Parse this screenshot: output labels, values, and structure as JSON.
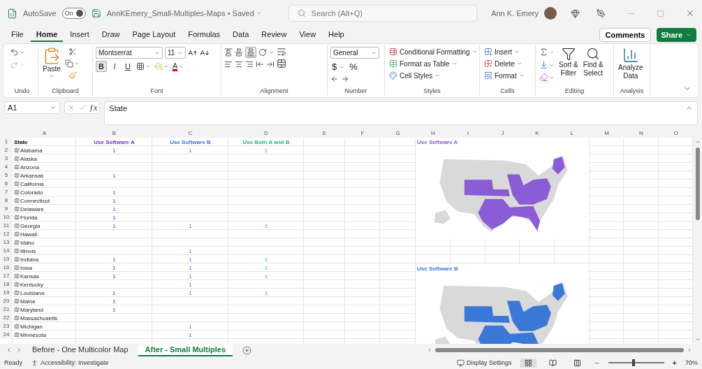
{
  "title_bar": {
    "autosave_label": "AutoSave",
    "autosave": {
      "on": true,
      "label": "On"
    },
    "file_name": "AnnKEmery_Small-Multiples-Maps • Saved",
    "search": {
      "placeholder": "Search (Alt+Q)"
    },
    "user_name": "Ann K. Emery"
  },
  "menu_tabs": [
    {
      "label": "File",
      "selected": false
    },
    {
      "label": "Home",
      "selected": true
    },
    {
      "label": "Insert",
      "selected": false
    },
    {
      "label": "Draw",
      "selected": false
    },
    {
      "label": "Page Layout",
      "selected": false
    },
    {
      "label": "Formulas",
      "selected": false
    },
    {
      "label": "Data",
      "selected": false
    },
    {
      "label": "Review",
      "selected": false
    },
    {
      "label": "View",
      "selected": false
    },
    {
      "label": "Help",
      "selected": false
    }
  ],
  "comments_button": "Comments",
  "share_button": "Share",
  "ribbon": [
    {
      "kind": "undo",
      "label": "Undo"
    },
    {
      "kind": "clipboard",
      "label": "Clipboard",
      "paste": "Paste"
    },
    {
      "kind": "font",
      "label": "Font",
      "family": "Montserrat",
      "size": "11",
      "bold": "B",
      "italic": "I",
      "underline": "U",
      "font_color": "A"
    },
    {
      "kind": "alignment",
      "label": "Alignment"
    },
    {
      "kind": "number",
      "label": "Number",
      "format": "General",
      "currency": "$",
      "percent": "%"
    },
    {
      "kind": "styles",
      "label": "Styles",
      "items": [
        "Conditional Formatting",
        "Format as Table",
        "Cell Styles"
      ]
    },
    {
      "kind": "cells",
      "label": "Cells",
      "items": [
        "Insert",
        "Delete",
        "Format"
      ]
    },
    {
      "kind": "editing",
      "label": "Editing",
      "sort": "Sort &\nFilter",
      "find": "Find &\nSelect"
    },
    {
      "kind": "analysis",
      "label": "Analysis",
      "analyze": "Analyze\nData"
    }
  ],
  "formula_bar": {
    "name_box": "A1",
    "fx": "ƒx",
    "formula": "State"
  },
  "sheet": {
    "columns": [
      "A",
      "B",
      "C",
      "D",
      "E",
      "F",
      "G",
      "H",
      "I",
      "J",
      "K",
      "L",
      "M",
      "N",
      "O"
    ],
    "header_row": {
      "number": "1",
      "cells": [
        {
          "text": "State",
          "color": "#000000"
        },
        {
          "text": "Use Software A",
          "color": "#7030d0"
        },
        {
          "text": "Use Software B",
          "color": "#3a72d8"
        },
        {
          "text": "Use Both A and B",
          "color": "#1fb874"
        }
      ]
    },
    "rows": [
      {
        "number": "2",
        "state": "Alabama",
        "a": "1",
        "b": "1",
        "both": "1"
      },
      {
        "number": "3",
        "state": "Alaska"
      },
      {
        "number": "4",
        "state": "Arizona"
      },
      {
        "number": "5",
        "state": "Arkansas",
        "a": "1"
      },
      {
        "number": "6",
        "state": "California"
      },
      {
        "number": "7",
        "state": "Colorado",
        "a": "1"
      },
      {
        "number": "8",
        "state": "Connecticut",
        "a": "1"
      },
      {
        "number": "9",
        "state": "Delaware",
        "a": "1"
      },
      {
        "number": "10",
        "state": "Florida",
        "a": "1"
      },
      {
        "number": "11",
        "state": "Georgia",
        "a": "1",
        "b": "1",
        "both": "1"
      },
      {
        "number": "12",
        "state": "Hawaii"
      },
      {
        "number": "13",
        "state": "Idaho"
      },
      {
        "number": "14",
        "state": "Illinois",
        "b": "1"
      },
      {
        "number": "15",
        "state": "Indiana",
        "a": "1",
        "b": "1",
        "both": "1"
      },
      {
        "number": "16",
        "state": "Iowa",
        "a": "1",
        "b": "1",
        "both": "1"
      },
      {
        "number": "17",
        "state": "Kansas",
        "a": "1",
        "b": "1",
        "both": "1"
      },
      {
        "number": "18",
        "state": "Kentucky",
        "b": "1"
      },
      {
        "number": "19",
        "state": "Louisiana",
        "a": "1",
        "b": "1",
        "both": "1"
      },
      {
        "number": "20",
        "state": "Maine",
        "a": "1"
      },
      {
        "number": "21",
        "state": "Maryland",
        "a": "1"
      },
      {
        "number": "22",
        "state": "Massachusetts"
      },
      {
        "number": "23",
        "state": "Michigan",
        "b": "1"
      },
      {
        "number": "24",
        "state": "Minnesota",
        "b": "1"
      }
    ],
    "maps": [
      {
        "title": "Use Software A",
        "color": "#8a5cd6",
        "kind": "picture"
      },
      {
        "title": "Use Software B",
        "color": "#3a78d8",
        "kind": "picture"
      }
    ]
  },
  "sheet_tabs": [
    {
      "label": "Before - One Multicolor Map",
      "selected": false
    },
    {
      "label": "After - Small Multiples",
      "selected": true
    }
  ],
  "status_bar": {
    "status": "Ready",
    "accessibility": "Accessibility: Investigate",
    "display_settings": "Display Settings",
    "zoom_in": "+",
    "zoom": "70%",
    "zoom_level": {
      "level": 0.45
    }
  }
}
